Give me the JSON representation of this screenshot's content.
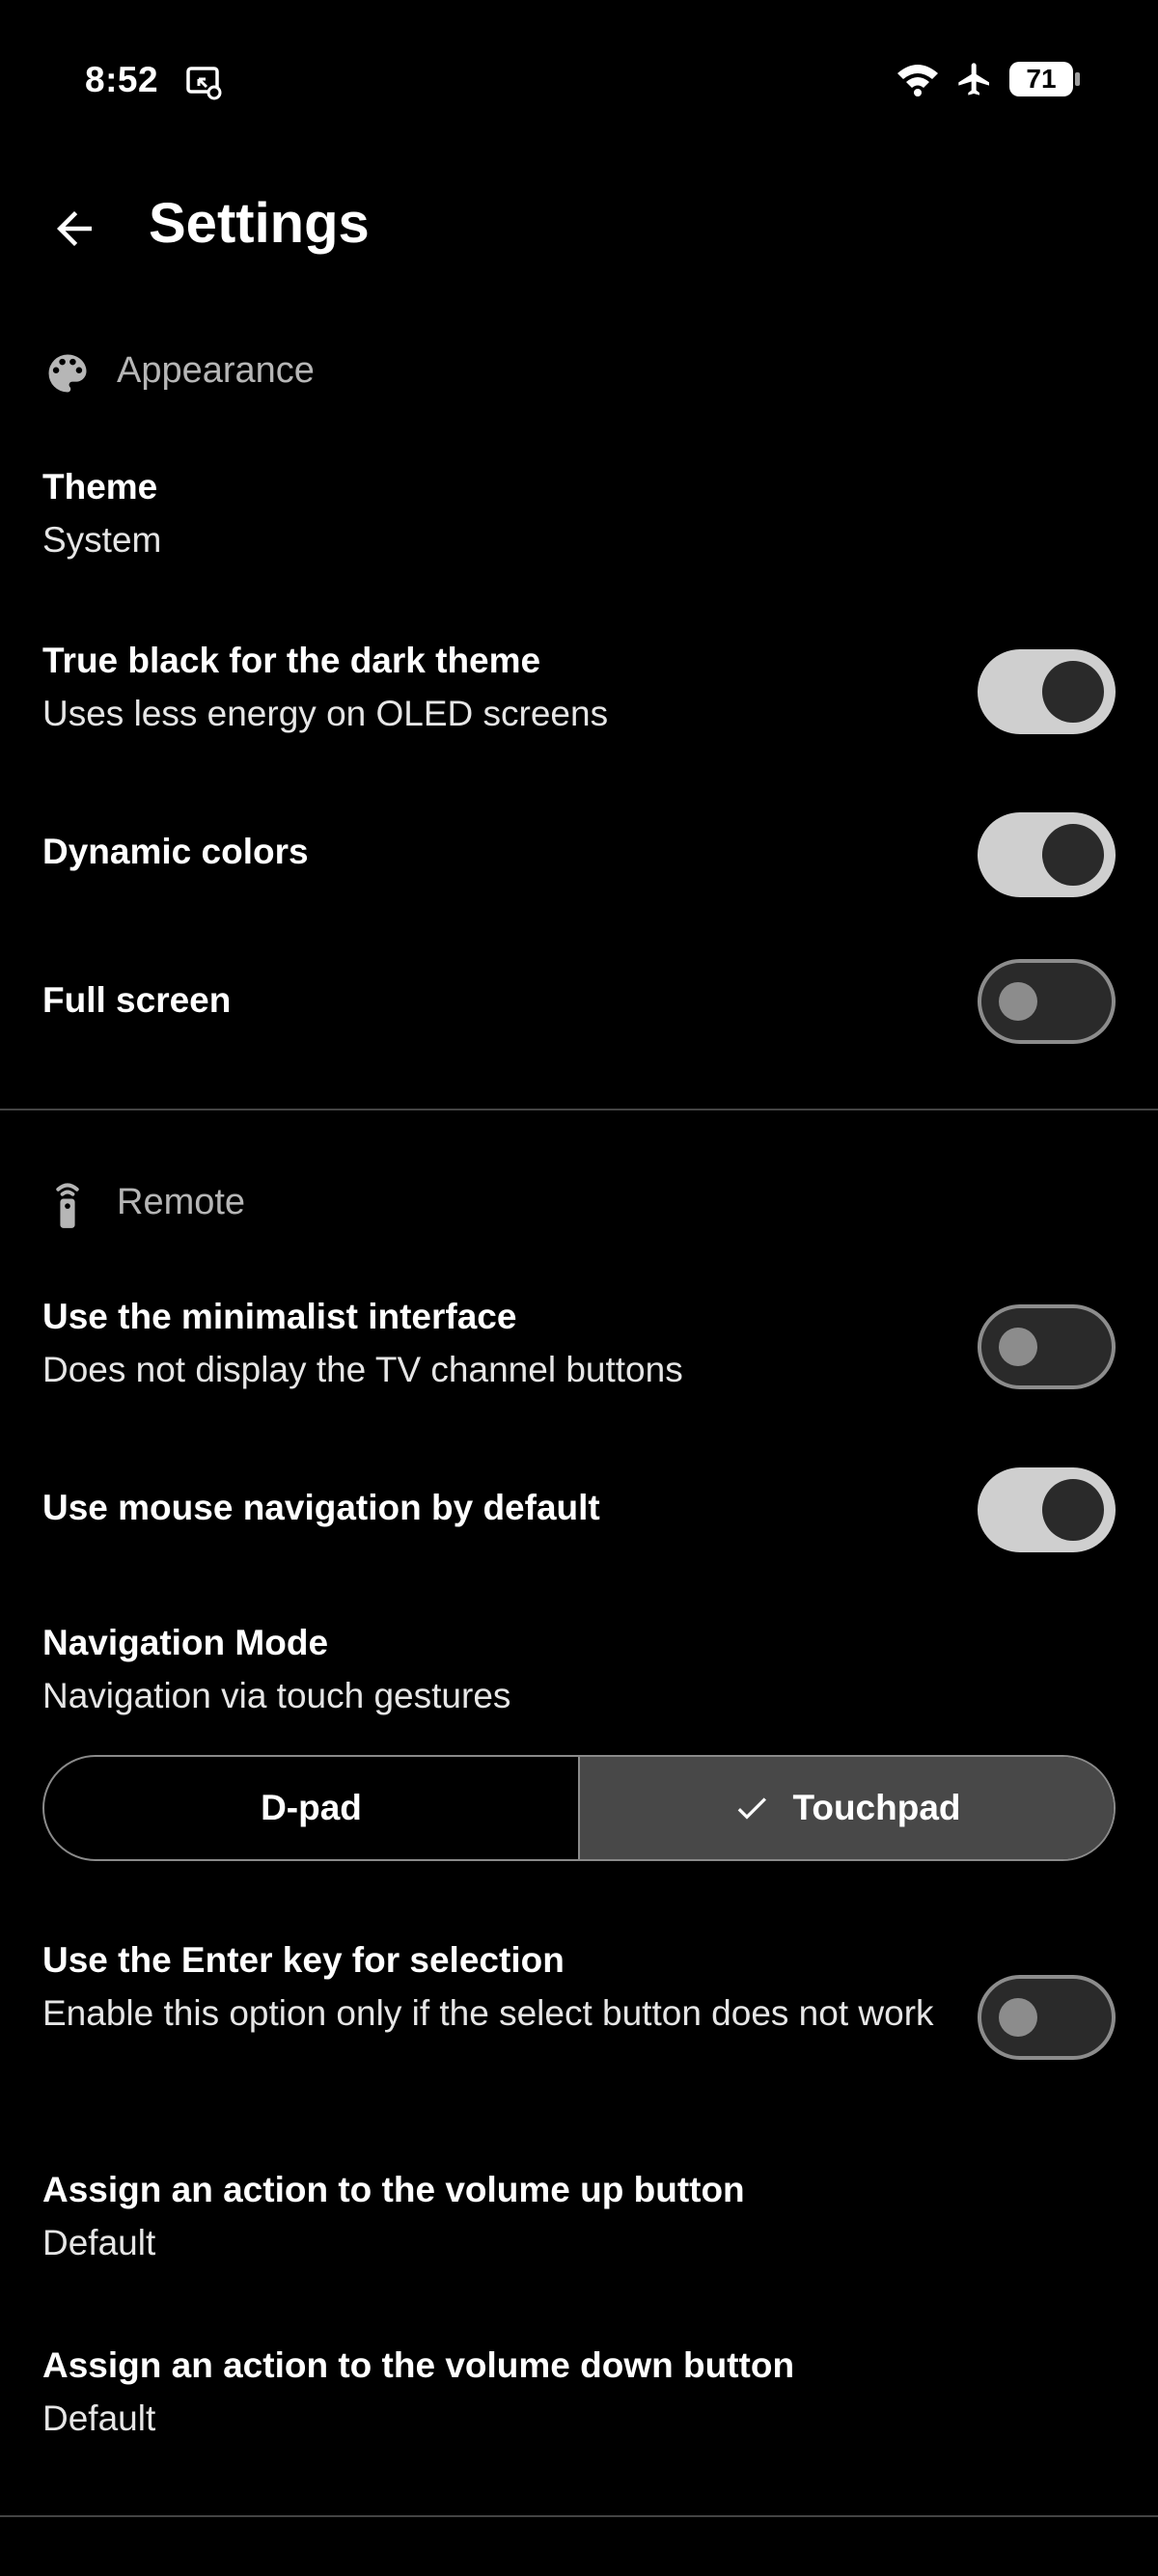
{
  "status_bar": {
    "time": "8:52",
    "battery": "71",
    "icons": [
      "screencast-icon",
      "wifi-icon",
      "airplane-icon",
      "battery-icon"
    ]
  },
  "app_bar": {
    "title": "Settings"
  },
  "sections": {
    "appearance": {
      "title": "Appearance",
      "icon": "palette-icon",
      "theme": {
        "title": "Theme",
        "value": "System"
      },
      "true_black": {
        "title": "True black for the dark theme",
        "subtitle": "Uses less energy on OLED screens",
        "enabled": true
      },
      "dynamic_colors": {
        "title": "Dynamic colors",
        "enabled": true
      },
      "full_screen": {
        "title": "Full screen",
        "enabled": false
      }
    },
    "remote": {
      "title": "Remote",
      "icon": "remote-control-icon",
      "minimalist": {
        "title": "Use the minimalist interface",
        "subtitle": "Does not display the TV channel buttons",
        "enabled": false
      },
      "mouse_nav": {
        "title": "Use mouse navigation by default",
        "enabled": true
      },
      "navigation_mode": {
        "title": "Navigation Mode",
        "subtitle": "Navigation via touch gestures",
        "options": [
          "D-pad",
          "Touchpad"
        ],
        "selected": "Touchpad"
      },
      "enter_key": {
        "title": "Use the Enter key for selection",
        "subtitle": "Enable this option only if the select button does not work",
        "enabled": false
      },
      "volume_up": {
        "title": "Assign an action to the volume up button",
        "value": "Default"
      },
      "volume_down": {
        "title": "Assign an action to the volume down button",
        "value": "Default"
      }
    }
  },
  "colors": {
    "background": "#000000",
    "toggle_on_track": "#cfcfcf",
    "toggle_off_border": "#8c8c8c",
    "selected_segment": "#484848",
    "section_header_text": "#b6b6b6"
  }
}
